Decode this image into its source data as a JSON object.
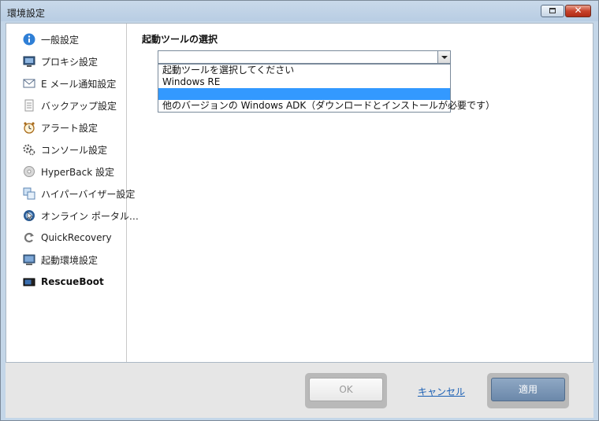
{
  "window": {
    "title": "環境設定",
    "close_glyph": "✕"
  },
  "sidebar": {
    "items": [
      {
        "label": "一般設定",
        "icon": "info-icon"
      },
      {
        "label": "プロキシ設定",
        "icon": "monitor-icon"
      },
      {
        "label": "E メール通知設定",
        "icon": "mail-icon"
      },
      {
        "label": "バックアップ設定",
        "icon": "document-icon"
      },
      {
        "label": "アラート設定",
        "icon": "alarm-clock-icon"
      },
      {
        "label": "コンソール設定",
        "icon": "gears-icon"
      },
      {
        "label": "HyperBack 設定",
        "icon": "disc-icon"
      },
      {
        "label": "ハイパーバイザー設定",
        "icon": "vm-icon"
      },
      {
        "label": "オンライン ポータル…",
        "icon": "portal-icon"
      },
      {
        "label": "QuickRecovery",
        "icon": "recovery-arrow-icon"
      },
      {
        "label": "起動環境設定",
        "icon": "screen-icon"
      },
      {
        "label": "RescueBoot",
        "icon": "rescueboot-icon"
      }
    ],
    "active_index": 11
  },
  "main": {
    "section_title": "起動ツールの選択",
    "combo_value": "",
    "options": [
      "起動ツールを選択してください",
      "Windows RE",
      "",
      "他のバージョンの Windows ADK（ダウンロードとインストールが必要です）"
    ],
    "selected_option_index": 2
  },
  "footer": {
    "ok_label": "OK",
    "cancel_label": "キャンセル",
    "apply_label": "適用"
  },
  "colors": {
    "selection": "#3399ff",
    "apply_button": "#7891b3",
    "link": "#1a5fb4"
  }
}
